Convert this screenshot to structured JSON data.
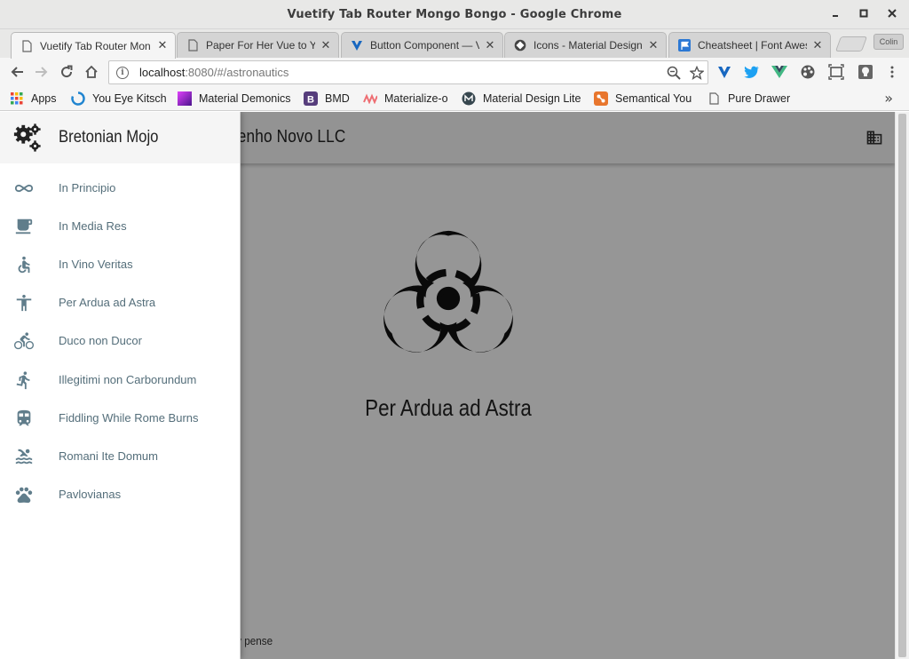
{
  "window": {
    "title": "Vuetify Tab Router Mongo Bongo - Google Chrome"
  },
  "tabs": [
    {
      "label": "Vuetify Tab Router Mon",
      "icon": "page-icon",
      "active": true
    },
    {
      "label": "Paper For Her Vue to Yo",
      "icon": "page-icon",
      "active": false
    },
    {
      "label": "Button Component — V",
      "icon": "vuetify-icon",
      "active": false
    },
    {
      "label": "Icons - Material Design",
      "icon": "material-icon",
      "active": false
    },
    {
      "label": "Cheatsheet | Font Awes",
      "icon": "flag-icon",
      "active": false
    }
  ],
  "profile_button": "Colin",
  "address_bar": {
    "host": "localhost",
    "path": ":8080/#/astronautics"
  },
  "bookmarks": [
    {
      "label": "Apps",
      "icon": "apps-grid-icon"
    },
    {
      "label": "You Eye Kitsch",
      "icon": "loader-icon"
    },
    {
      "label": "Material Demonics",
      "icon": "gradient-square-icon"
    },
    {
      "label": "BMD",
      "icon": "bootstrap-icon"
    },
    {
      "label": "Materialize-o",
      "icon": "materialize-icon"
    },
    {
      "label": "Material Design Lite",
      "icon": "mdl-icon"
    },
    {
      "label": "Semantical You",
      "icon": "semantic-icon"
    },
    {
      "label": "Pure Drawer",
      "icon": "page-icon"
    }
  ],
  "app": {
    "toolbar_title": "genho Novo LLC",
    "toolbar_icon": "business-icon",
    "hero_icon": "biohazard-icon",
    "hero_caption": "Per Ardua ad Astra",
    "footer": "tónio e honi soit qui mal y pense"
  },
  "drawer": {
    "title": "Bretonian Mojo",
    "header_icon": "settings-gears-icon",
    "items": [
      {
        "label": "In Principio",
        "icon": "infinity-icon"
      },
      {
        "label": "In Media Res",
        "icon": "cup-icon"
      },
      {
        "label": "In Vino Veritas",
        "icon": "accessible-icon"
      },
      {
        "label": "Per Ardua ad Astra",
        "icon": "accessibility-icon"
      },
      {
        "label": "Duco non Ducor",
        "icon": "bike-icon"
      },
      {
        "label": "Illegitimi non Carborundum",
        "icon": "run-icon"
      },
      {
        "label": "Fiddling While Rome Burns",
        "icon": "train-icon"
      },
      {
        "label": "Romani Ite Domum",
        "icon": "pool-icon"
      },
      {
        "label": "Pavlovianas",
        "icon": "pets-icon"
      }
    ]
  },
  "colors": {
    "nav_label": "#546e7a",
    "nav_icon": "#607d8b",
    "scrim": "rgba(0,0,0,0.40)"
  }
}
